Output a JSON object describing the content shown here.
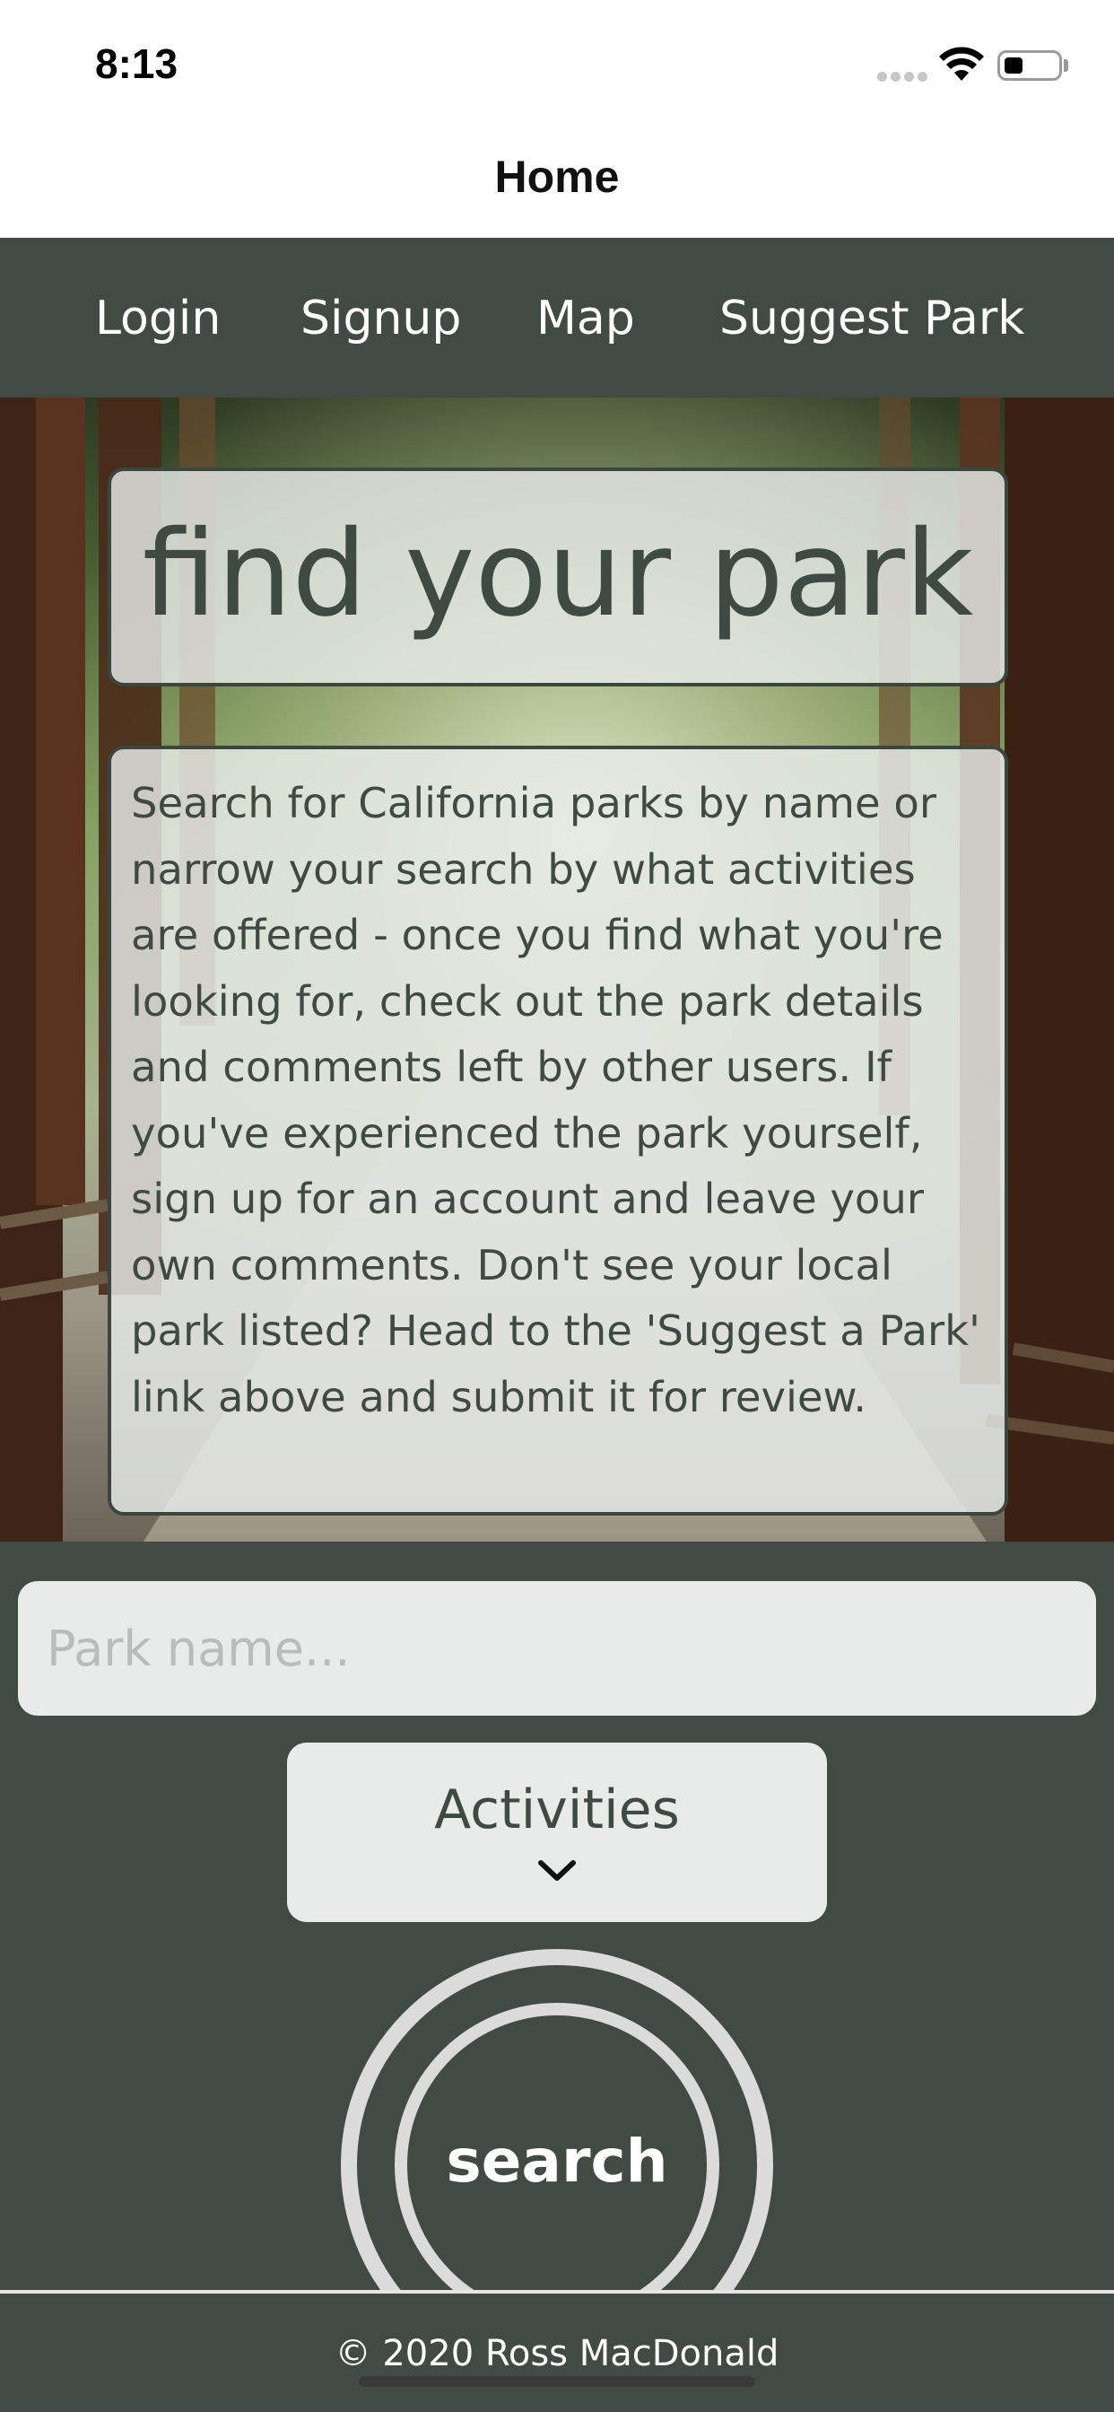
{
  "status_bar": {
    "time": "8:13",
    "battery_level": 0.35
  },
  "header": {
    "title": "Home"
  },
  "nav": {
    "items": [
      {
        "label": "Login"
      },
      {
        "label": "Signup"
      },
      {
        "label": "Map"
      },
      {
        "label": "Suggest Park"
      }
    ]
  },
  "hero": {
    "title": "find your park",
    "description": "Search for California parks by name or narrow your search by what activities are offered - once you find what you're looking for, check out the park details and comments left by other users. If you've experienced the park yourself, sign up for an account and leave your own comments. Don't see your local park listed? Head to the 'Suggest a Park' link above and submit it for review.",
    "background_image": "redwood-forest-path"
  },
  "search_form": {
    "park_name_placeholder": "Park name...",
    "park_name_value": "",
    "activities_label": "Activities",
    "activities_icon": "chevron-down-icon",
    "search_label": "search"
  },
  "footer": {
    "copyright": "© 2020 Ross MacDonald"
  },
  "colors": {
    "brand_dark": "#414b44",
    "card_bg": "#e9ebea",
    "text_dark": "#3f4a42",
    "ring": "#dadbda"
  }
}
